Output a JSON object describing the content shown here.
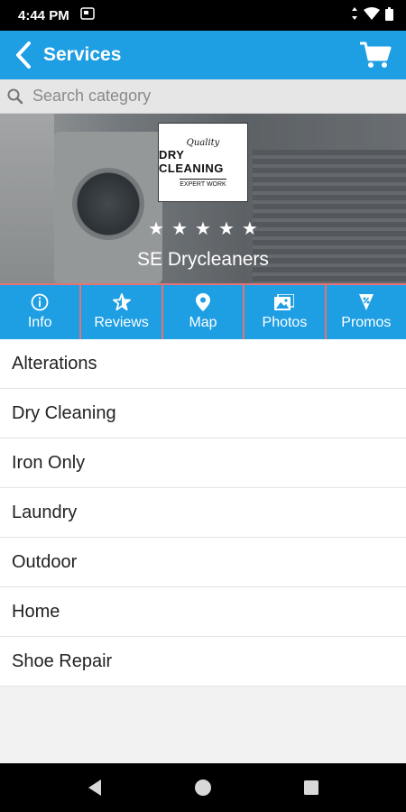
{
  "status_bar": {
    "time": "4:44 PM"
  },
  "app_bar": {
    "title": "Services"
  },
  "search": {
    "placeholder": "Search category"
  },
  "hero": {
    "logo_top": "Quality",
    "logo_mid": "DRY CLEANING",
    "logo_bottom": "EXPERT WORK",
    "rating": 5,
    "business_name": "SE Drycleaners"
  },
  "tabs": [
    {
      "label": "Info",
      "icon": "info-icon"
    },
    {
      "label": "Reviews",
      "icon": "star-icon"
    },
    {
      "label": "Map",
      "icon": "map-pin-icon"
    },
    {
      "label": "Photos",
      "icon": "photos-icon"
    },
    {
      "label": "Promos",
      "icon": "promo-icon"
    }
  ],
  "categories": [
    "Alterations",
    "Dry Cleaning",
    "Iron Only",
    "Laundry",
    "Outdoor",
    "Home",
    "Shoe Repair"
  ],
  "colors": {
    "primary": "#1e9ee3",
    "tab_divider": "#e57373"
  }
}
